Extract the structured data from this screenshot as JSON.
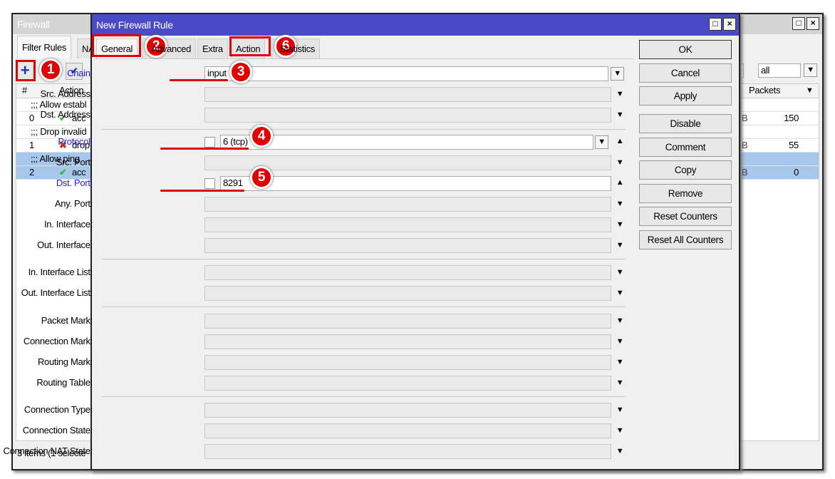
{
  "firewall": {
    "title": "Firewall",
    "tabs": [
      "Filter Rules",
      "NAT"
    ],
    "filter_value": "all",
    "columns": [
      "#",
      "",
      "Action",
      "Packets"
    ],
    "rows": [
      {
        "type": "comment",
        "text": ";;; Allow establ",
        "selected": false
      },
      {
        "type": "rule",
        "num": "0",
        "action": "acc",
        "icon": "check-icon",
        "packets": "150",
        "selected": false
      },
      {
        "type": "comment",
        "text": ";;; Drop invalid",
        "selected": false
      },
      {
        "type": "rule",
        "num": "1",
        "action": "drop",
        "icon": "x-icon",
        "packets": "55",
        "selected": false
      },
      {
        "type": "comment",
        "text": ";;; Allow ping",
        "selected": true
      },
      {
        "type": "rule",
        "num": "2",
        "action": "acc",
        "icon": "check-icon",
        "packets": "0",
        "selected": true
      }
    ],
    "status": "3 items (1 selecte"
  },
  "dialog": {
    "title": "New Firewall Rule",
    "tabs": [
      "General",
      "Advanced",
      "Extra",
      "Action",
      "Statistics"
    ],
    "tabs_visible": [
      "General",
      "nced",
      "Extra",
      "Action",
      "tics"
    ],
    "fields": {
      "chain": {
        "label": "Chain:",
        "value": "input"
      },
      "src_address": "Src. Address:",
      "dst_address": "Dst. Address:",
      "protocol": {
        "label": "Protocol:",
        "value": "6 (tcp)"
      },
      "src_port": "Src. Port:",
      "dst_port": {
        "label": "Dst. Port:",
        "value": "8291"
      },
      "any_port": "Any. Port:",
      "in_interface": "In. Interface:",
      "out_interface": "Out. Interface:",
      "in_interface_list": "In. Interface List:",
      "out_interface_list": "Out. Interface List:",
      "packet_mark": "Packet Mark:",
      "connection_mark": "Connection Mark:",
      "routing_mark": "Routing Mark:",
      "routing_table": "Routing Table:",
      "connection_type": "Connection Type:",
      "connection_state": "Connection State:",
      "connection_nat_state": "Connection NAT State:"
    },
    "buttons": [
      "OK",
      "Cancel",
      "Apply",
      "Disable",
      "Comment",
      "Copy",
      "Remove",
      "Reset Counters",
      "Reset All Counters"
    ]
  },
  "annotations": [
    "1",
    "2",
    "3",
    "4",
    "5",
    "6"
  ],
  "colors": {
    "annotation": "#e00000",
    "title_active": "#4a4ac8",
    "link_label": "#2020d0",
    "selection": "#a6c8ec"
  }
}
